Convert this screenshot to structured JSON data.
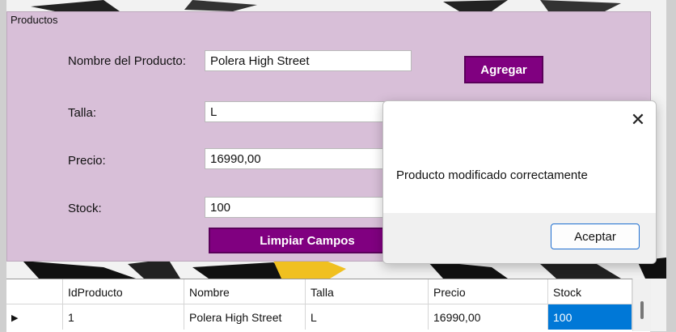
{
  "group": {
    "title": "Productos"
  },
  "form": {
    "nombre_label": "Nombre del Producto:",
    "nombre_value": "Polera High Street",
    "talla_label": "Talla:",
    "talla_value": "L",
    "precio_label": "Precio:",
    "precio_value": "16990,00",
    "stock_label": "Stock:",
    "stock_value": "100",
    "agregar_label": "Agregar",
    "limpiar_label": "Limpiar Campos"
  },
  "table": {
    "headers": [
      "IdProducto",
      "Nombre",
      "Talla",
      "Precio",
      "Stock"
    ],
    "row": [
      "1",
      "Polera High Street",
      "L",
      "16990,00",
      "100"
    ],
    "row_indicator": "▶"
  },
  "dialog": {
    "message": "Producto modificado correctamente",
    "close_glyph": "✕",
    "ok_label": "Aceptar"
  },
  "colors": {
    "accent": "#800080",
    "group_bg": "#d8bfd8",
    "selection": "#0078d7"
  }
}
